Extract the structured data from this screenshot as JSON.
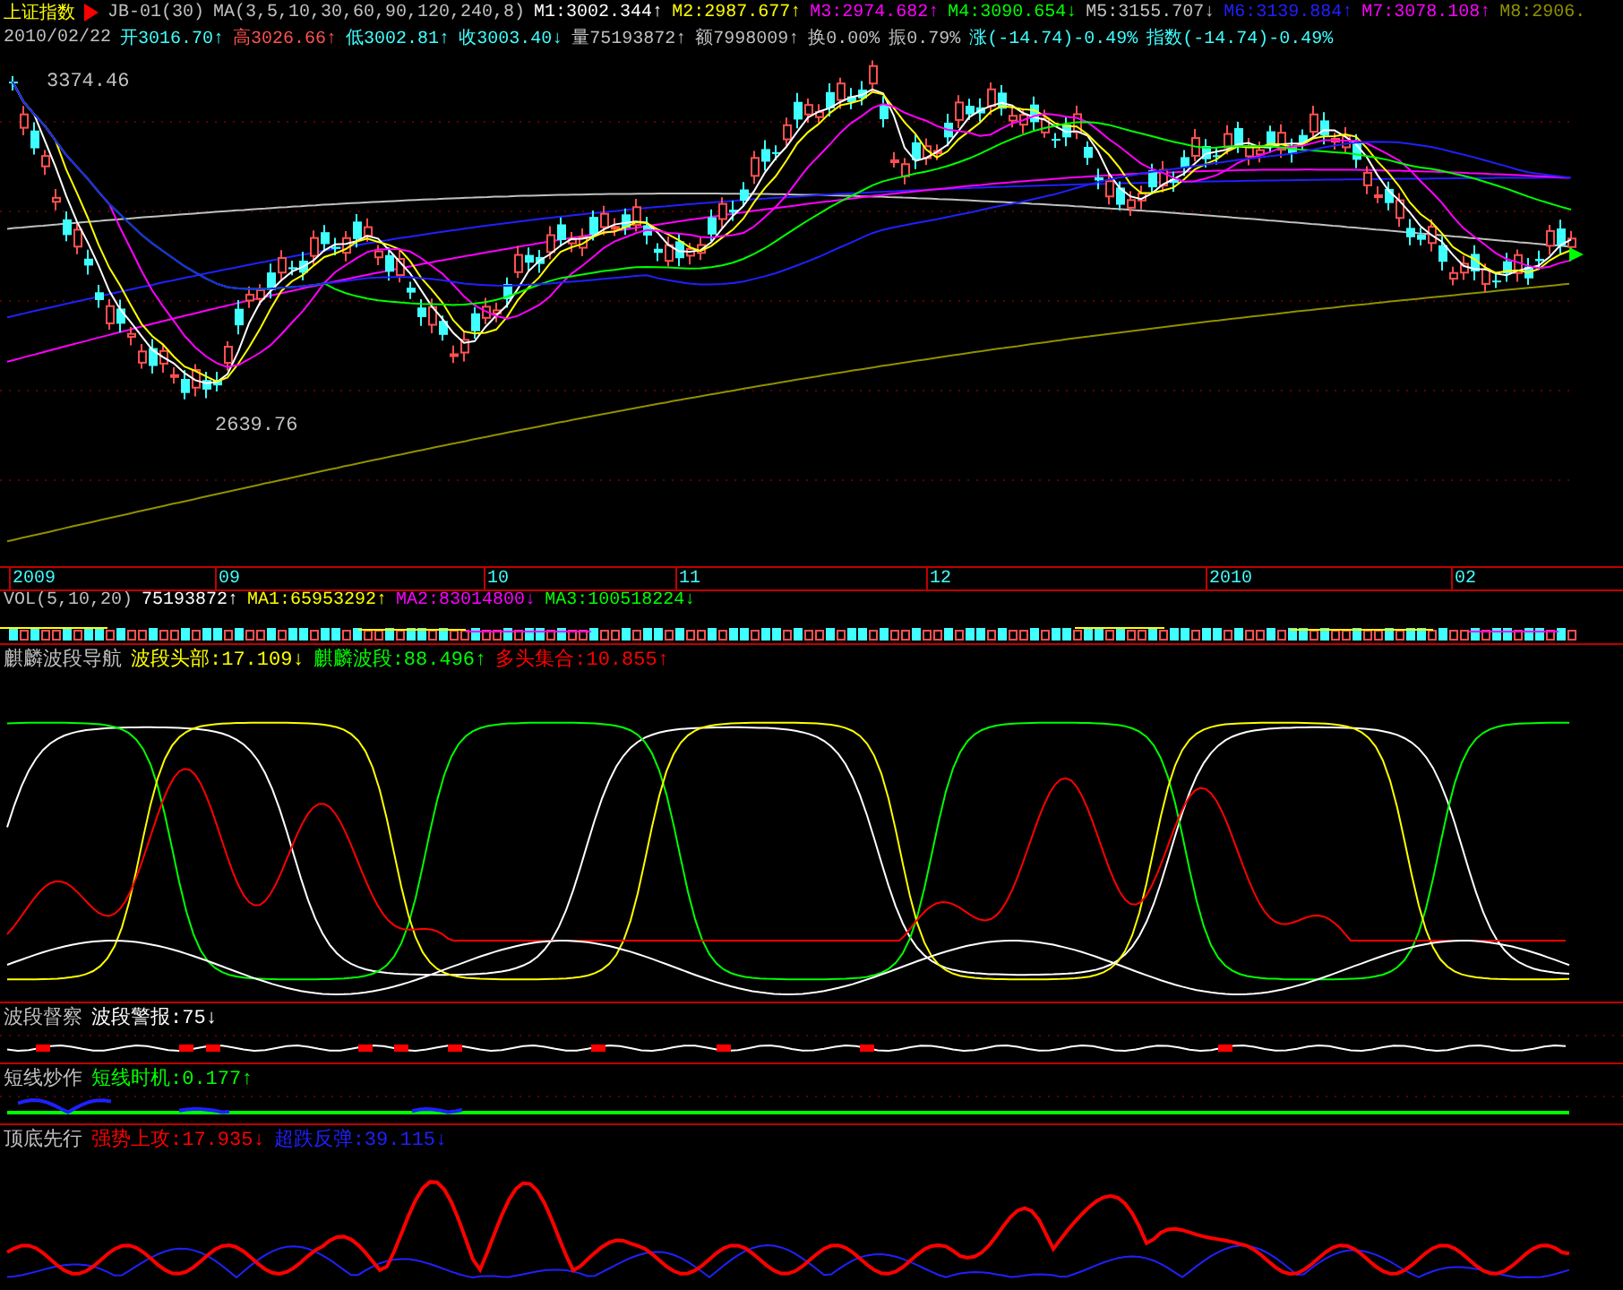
{
  "header": {
    "index_name": "上证指数",
    "line1": [
      {
        "text": "JB-01(30)",
        "color": "#c0c0c0"
      },
      {
        "text": "MA(3,5,10,30,60,90,120,240,8)",
        "color": "#c0c0c0"
      },
      {
        "text": "M1:3002.344↑",
        "color": "#ffffff"
      },
      {
        "text": "M2:2987.677↑",
        "color": "#ffff00"
      },
      {
        "text": "M3:2974.682↑",
        "color": "#ff00ff"
      },
      {
        "text": "M4:3090.654↓",
        "color": "#00ff00"
      },
      {
        "text": "M5:3155.707↓",
        "color": "#c0c0c0"
      },
      {
        "text": "M6:3139.884↑",
        "color": "#2020ff"
      },
      {
        "text": "M7:3078.108↑",
        "color": "#ff00ff"
      },
      {
        "text": "M8:2906.",
        "color": "#909000"
      }
    ],
    "date": "2010/02/22",
    "line2": [
      {
        "text": "开3016.70↑",
        "color": "#40ffff"
      },
      {
        "text": "高3026.66↑",
        "color": "#ff5050"
      },
      {
        "text": "低3002.81↑",
        "color": "#40ffff"
      },
      {
        "text": "收3003.40↓",
        "color": "#40ffff"
      },
      {
        "text": "量75193872↑",
        "color": "#c0c0c0"
      },
      {
        "text": "额7998009↑",
        "color": "#c0c0c0"
      },
      {
        "text": "换0.00%",
        "color": "#c0c0c0"
      },
      {
        "text": "振0.79%",
        "color": "#c0c0c0"
      },
      {
        "text": "涨(-14.74)-0.49%",
        "color": "#40ffff"
      },
      {
        "text": "指数(-14.74)-0.49%",
        "color": "#40ffff"
      }
    ]
  },
  "main_chart": {
    "high_label": "3374.46",
    "low_label": "2639.76"
  },
  "x_axis": [
    "2009",
    "09",
    "10",
    "11",
    "12",
    "2010",
    "02"
  ],
  "volume": {
    "label": "VOL(5,10,20)",
    "values": [
      {
        "text": "75193872↑",
        "color": "#ffffff"
      },
      {
        "text": "MA1:65953292↑",
        "color": "#ffff00"
      },
      {
        "text": "MA2:83014800↓",
        "color": "#ff00ff"
      },
      {
        "text": "MA3:100518224↓",
        "color": "#00ff00"
      }
    ]
  },
  "panels": [
    {
      "kind": "wave",
      "title": "麒麟波段导航",
      "values": [
        {
          "text": "波段头部:17.109↓",
          "color": "#ffff00"
        },
        {
          "text": "麒麟波段:88.496↑",
          "color": "#00ff00"
        },
        {
          "text": "多头集合:10.855↑",
          "color": "#ff0000"
        }
      ]
    },
    {
      "kind": "alert",
      "title": "波段督察",
      "values": [
        {
          "text": "波段警报:75↓",
          "color": "#ffffff"
        }
      ]
    },
    {
      "kind": "short",
      "title": "短线炒作",
      "values": [
        {
          "text": "短线时机:0.177↑",
          "color": "#00ff00"
        }
      ]
    },
    {
      "kind": "topbottom",
      "title": "顶底先行",
      "values": [
        {
          "text": "强势上攻:17.935↓",
          "color": "#ff0000"
        },
        {
          "text": "超跌反弹:39.115↓",
          "color": "#2020ff"
        }
      ]
    }
  ]
}
